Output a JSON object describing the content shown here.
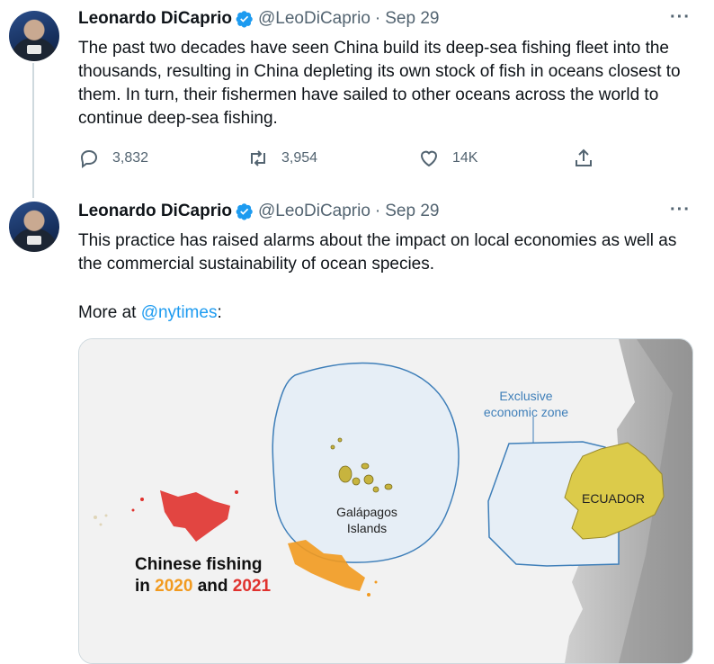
{
  "tweets": [
    {
      "author": "Leonardo DiCaprio",
      "handle": "@LeoDiCaprio",
      "sep": "·",
      "date": "Sep 29",
      "text": "The past two decades have seen China build its deep-sea fishing fleet into the thousands, resulting in China depleting its own stock of fish in oceans closest to them. In turn, their fishermen have sailed to other oceans across the world to continue deep-sea fishing.",
      "replies": "3,832",
      "retweets": "3,954",
      "likes": "14K"
    },
    {
      "author": "Leonardo DiCaprio",
      "handle": "@LeoDiCaprio",
      "sep": "·",
      "date": "Sep 29",
      "text": "This practice has raised alarms about the impact on local economies as well as the commercial sustainability of ocean species.",
      "more_prefix": "More at ",
      "more_link": "@nytimes",
      "more_suffix": ":"
    }
  ],
  "map": {
    "eez_label_line1": "Exclusive",
    "eez_label_line2": "economic zone",
    "galapagos_line1": "Galápagos",
    "galapagos_line2": "Islands",
    "ecuador": "ECUADOR",
    "legend_line1": "Chinese fishing",
    "legend_in": "in ",
    "legend_year1": "2020",
    "legend_and": " and ",
    "legend_year2": "2021"
  },
  "colors": {
    "accent": "#1d9bf0",
    "year_2020": "#f29a1f",
    "year_2021": "#e0322e",
    "eez_outline": "#3f7fb9",
    "ecuador_fill": "#dccb4a"
  }
}
